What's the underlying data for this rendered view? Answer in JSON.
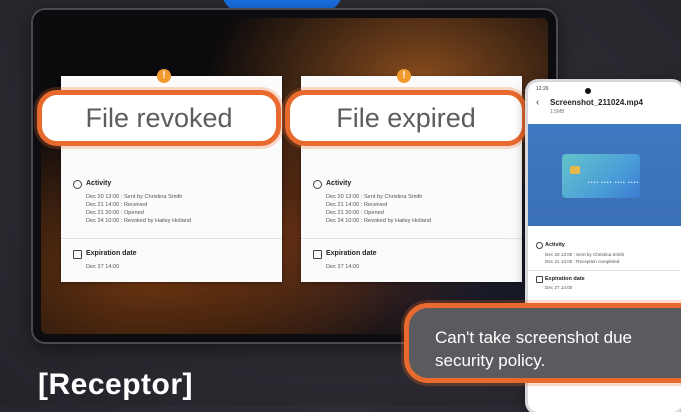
{
  "caption": "[Receptor]",
  "colors": {
    "accent": "#e86a2e",
    "brand_blue": "#1a73e8",
    "toast_bg": "#5a5a5f"
  },
  "badge": {
    "icon": "shield-check-icon"
  },
  "cards": [
    {
      "status": "File revoked",
      "activity_title": "Activity",
      "activity_lines": [
        "Dec 20 13:00 : Sent by Christina Smith",
        "Dec 21 14:00 : Received",
        "Dec 21 20:00 : Opened",
        "Dec 24 10:00 : Revoked by Hailey Holland"
      ],
      "expiration_title": "Expiration date",
      "expiration_value": "Dec 27 14:00"
    },
    {
      "status": "File expired",
      "activity_title": "Activity",
      "activity_lines": [
        "Dec 20 13:00 : Sent by Christina Smith",
        "Dec 21 14:00 : Received",
        "Dec 21 20:00 : Opened",
        "Dec 24 10:00 : Revoked by Hailey Holland"
      ],
      "expiration_title": "Expiration date",
      "expiration_value": "Dec 27 14:00"
    }
  ],
  "phone": {
    "status_time": "12:26",
    "file_title": "Screenshot_211024.mp4",
    "file_size": "1.5MB",
    "card_digits": "•••• •••• •••• ••••",
    "activity_title": "Activity",
    "activity_lines": [
      "Dec 20 13:00 : Sent by Christina Smith",
      "Dec 21 14:00 : Reception completed"
    ],
    "expiration_title": "Expiration date",
    "expiration_value": "Dec 27 14:00"
  },
  "toast": {
    "line1": "Can't take screenshot due",
    "line2": "security policy."
  }
}
